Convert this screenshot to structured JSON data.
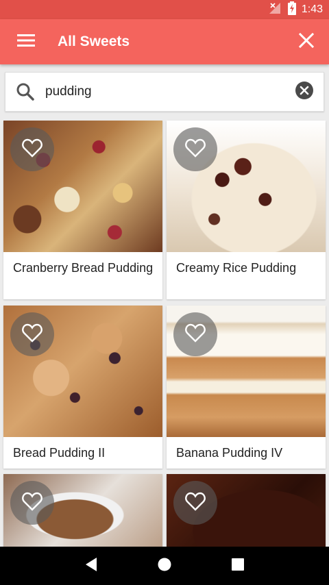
{
  "status_bar": {
    "time": "1:43",
    "icons": [
      "no-signal-icon",
      "battery-charging-icon"
    ]
  },
  "app_bar": {
    "title": "All Sweets",
    "menu_icon": "hamburger-menu-icon",
    "close_icon": "close-icon",
    "color": "#f4645d"
  },
  "search": {
    "value": "pudding",
    "placeholder": "Search",
    "search_icon": "search-icon",
    "clear_icon": "clear-circle-icon"
  },
  "recipes": [
    {
      "title": "Cranberry Bread Pudding",
      "favorite_icon": "heart-outline-icon"
    },
    {
      "title": "Creamy Rice Pudding",
      "favorite_icon": "heart-outline-icon"
    },
    {
      "title": "Bread Pudding II",
      "favorite_icon": "heart-outline-icon"
    },
    {
      "title": "Banana Pudding IV",
      "favorite_icon": "heart-outline-icon"
    },
    {
      "title": "",
      "favorite_icon": "heart-outline-icon"
    },
    {
      "title": "",
      "favorite_icon": "heart-outline-icon"
    }
  ],
  "nav_bar": {
    "icons": [
      "back-icon",
      "home-icon",
      "recents-icon"
    ]
  }
}
